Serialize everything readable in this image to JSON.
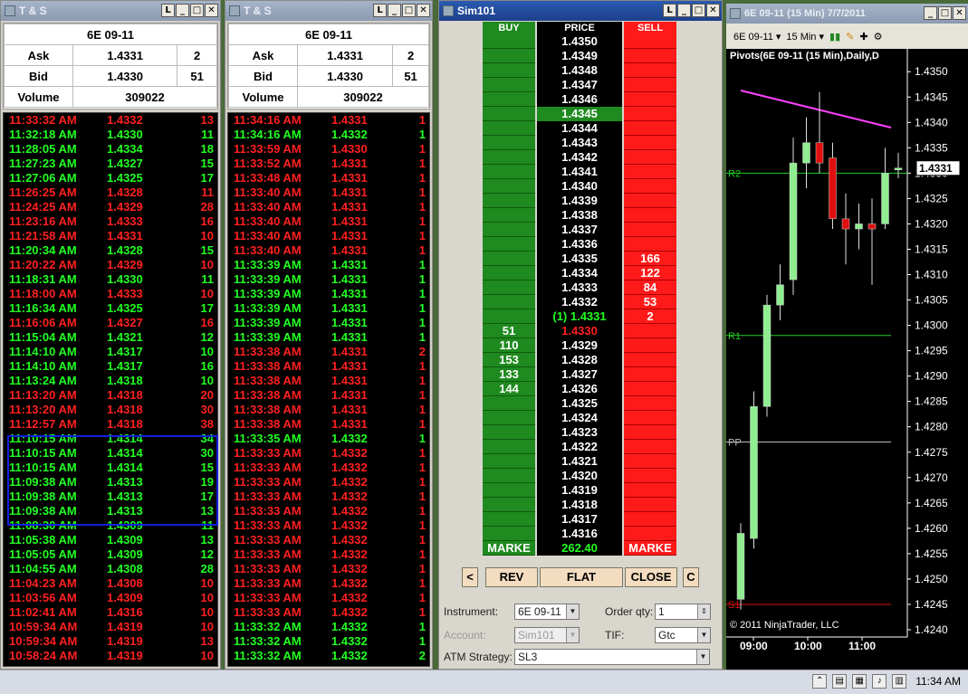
{
  "ts1": {
    "title": "T & S",
    "instrument": "6E 09-11",
    "ask_label": "Ask",
    "ask_price": "1.4331",
    "ask_size": "2",
    "bid_label": "Bid",
    "bid_price": "1.4330",
    "bid_size": "51",
    "volume_label": "Volume",
    "volume": "309022",
    "trades": [
      [
        "11:33:32 AM",
        "1.4332",
        "13",
        "r"
      ],
      [
        "11:32:18 AM",
        "1.4330",
        "11",
        "g"
      ],
      [
        "11:28:05 AM",
        "1.4334",
        "18",
        "g"
      ],
      [
        "11:27:23 AM",
        "1.4327",
        "15",
        "g"
      ],
      [
        "11:27:06 AM",
        "1.4325",
        "17",
        "g"
      ],
      [
        "11:26:25 AM",
        "1.4328",
        "11",
        "r"
      ],
      [
        "11:24:25 AM",
        "1.4329",
        "28",
        "r"
      ],
      [
        "11:23:16 AM",
        "1.4333",
        "16",
        "r"
      ],
      [
        "11:21:58 AM",
        "1.4331",
        "10",
        "r"
      ],
      [
        "11:20:34 AM",
        "1.4328",
        "15",
        "g"
      ],
      [
        "11:20:22 AM",
        "1.4329",
        "10",
        "r"
      ],
      [
        "11:18:31 AM",
        "1.4330",
        "11",
        "g"
      ],
      [
        "11:18:00 AM",
        "1.4333",
        "10",
        "r"
      ],
      [
        "11:16:34 AM",
        "1.4325",
        "17",
        "g"
      ],
      [
        "11:16:06 AM",
        "1.4327",
        "16",
        "r"
      ],
      [
        "11:15:04 AM",
        "1.4321",
        "12",
        "g"
      ],
      [
        "11:14:10 AM",
        "1.4317",
        "10",
        "g"
      ],
      [
        "11:14:10 AM",
        "1.4317",
        "16",
        "g"
      ],
      [
        "11:13:24 AM",
        "1.4318",
        "10",
        "g"
      ],
      [
        "11:13:20 AM",
        "1.4318",
        "20",
        "r"
      ],
      [
        "11:13:20 AM",
        "1.4318",
        "30",
        "r"
      ],
      [
        "11:12:57 AM",
        "1.4318",
        "38",
        "r"
      ],
      [
        "11:10:15 AM",
        "1.4314",
        "34",
        "g"
      ],
      [
        "11:10:15 AM",
        "1.4314",
        "30",
        "g"
      ],
      [
        "11:10:15 AM",
        "1.4314",
        "15",
        "g"
      ],
      [
        "11:09:38 AM",
        "1.4313",
        "19",
        "g"
      ],
      [
        "11:09:38 AM",
        "1.4313",
        "17",
        "g"
      ],
      [
        "11:09:38 AM",
        "1.4313",
        "13",
        "g"
      ],
      [
        "11:08:30 AM",
        "1.4309",
        "11",
        "g"
      ],
      [
        "11:05:38 AM",
        "1.4309",
        "13",
        "g"
      ],
      [
        "11:05:05 AM",
        "1.4309",
        "12",
        "g"
      ],
      [
        "11:04:55 AM",
        "1.4308",
        "28",
        "g"
      ],
      [
        "11:04:23 AM",
        "1.4308",
        "10",
        "r"
      ],
      [
        "11:03:56 AM",
        "1.4309",
        "10",
        "r"
      ],
      [
        "11:02:41 AM",
        "1.4316",
        "10",
        "r"
      ],
      [
        "10:59:34 AM",
        "1.4319",
        "10",
        "r"
      ],
      [
        "10:59:34 AM",
        "1.4319",
        "13",
        "r"
      ],
      [
        "10:58:24 AM",
        "1.4319",
        "10",
        "r"
      ]
    ]
  },
  "ts2": {
    "title": "T & S",
    "instrument": "6E 09-11",
    "ask_label": "Ask",
    "ask_price": "1.4331",
    "ask_size": "2",
    "bid_label": "Bid",
    "bid_price": "1.4330",
    "bid_size": "51",
    "volume_label": "Volume",
    "volume": "309022",
    "trades": [
      [
        "11:34:16 AM",
        "1.4331",
        "1",
        "r"
      ],
      [
        "11:34:16 AM",
        "1.4332",
        "1",
        "g"
      ],
      [
        "11:33:59 AM",
        "1.4330",
        "1",
        "r"
      ],
      [
        "11:33:52 AM",
        "1.4331",
        "1",
        "r"
      ],
      [
        "11:33:48 AM",
        "1.4331",
        "1",
        "r"
      ],
      [
        "11:33:40 AM",
        "1.4331",
        "1",
        "r"
      ],
      [
        "11:33:40 AM",
        "1.4331",
        "1",
        "r"
      ],
      [
        "11:33:40 AM",
        "1.4331",
        "1",
        "r"
      ],
      [
        "11:33:40 AM",
        "1.4331",
        "1",
        "r"
      ],
      [
        "11:33:40 AM",
        "1.4331",
        "1",
        "r"
      ],
      [
        "11:33:39 AM",
        "1.4331",
        "1",
        "g"
      ],
      [
        "11:33:39 AM",
        "1.4331",
        "1",
        "g"
      ],
      [
        "11:33:39 AM",
        "1.4331",
        "1",
        "g"
      ],
      [
        "11:33:39 AM",
        "1.4331",
        "1",
        "g"
      ],
      [
        "11:33:39 AM",
        "1.4331",
        "1",
        "g"
      ],
      [
        "11:33:39 AM",
        "1.4331",
        "1",
        "g"
      ],
      [
        "11:33:38 AM",
        "1.4331",
        "2",
        "r"
      ],
      [
        "11:33:38 AM",
        "1.4331",
        "1",
        "r"
      ],
      [
        "11:33:38 AM",
        "1.4331",
        "1",
        "r"
      ],
      [
        "11:33:38 AM",
        "1.4331",
        "1",
        "r"
      ],
      [
        "11:33:38 AM",
        "1.4331",
        "1",
        "r"
      ],
      [
        "11:33:38 AM",
        "1.4331",
        "1",
        "r"
      ],
      [
        "11:33:35 AM",
        "1.4332",
        "1",
        "g"
      ],
      [
        "11:33:33 AM",
        "1.4332",
        "1",
        "r"
      ],
      [
        "11:33:33 AM",
        "1.4332",
        "1",
        "r"
      ],
      [
        "11:33:33 AM",
        "1.4332",
        "1",
        "r"
      ],
      [
        "11:33:33 AM",
        "1.4332",
        "1",
        "r"
      ],
      [
        "11:33:33 AM",
        "1.4332",
        "1",
        "r"
      ],
      [
        "11:33:33 AM",
        "1.4332",
        "1",
        "r"
      ],
      [
        "11:33:33 AM",
        "1.4332",
        "1",
        "r"
      ],
      [
        "11:33:33 AM",
        "1.4332",
        "1",
        "r"
      ],
      [
        "11:33:33 AM",
        "1.4332",
        "1",
        "r"
      ],
      [
        "11:33:33 AM",
        "1.4332",
        "1",
        "r"
      ],
      [
        "11:33:33 AM",
        "1.4332",
        "1",
        "r"
      ],
      [
        "11:33:33 AM",
        "1.4332",
        "1",
        "r"
      ],
      [
        "11:33:32 AM",
        "1.4332",
        "1",
        "g"
      ],
      [
        "11:33:32 AM",
        "1.4332",
        "1",
        "g"
      ],
      [
        "11:33:32 AM",
        "1.4332",
        "2",
        "g"
      ]
    ]
  },
  "dom": {
    "title": "Sim101",
    "col_buy": "BUY",
    "col_price": "PRICE",
    "col_sell": "SELL",
    "rows": [
      [
        "",
        "1.4350",
        ""
      ],
      [
        "",
        "1.4349",
        ""
      ],
      [
        "",
        "1.4348",
        ""
      ],
      [
        "",
        "1.4347",
        ""
      ],
      [
        "",
        "1.4346",
        ""
      ],
      [
        "",
        "1.4345",
        ""
      ],
      [
        "",
        "1.4344",
        ""
      ],
      [
        "",
        "1.4343",
        ""
      ],
      [
        "",
        "1.4342",
        ""
      ],
      [
        "",
        "1.4341",
        ""
      ],
      [
        "",
        "1.4340",
        ""
      ],
      [
        "",
        "1.4339",
        ""
      ],
      [
        "",
        "1.4338",
        ""
      ],
      [
        "",
        "1.4337",
        ""
      ],
      [
        "",
        "1.4336",
        ""
      ],
      [
        "",
        "1.4335",
        "166"
      ],
      [
        "",
        "1.4334",
        "122"
      ],
      [
        "",
        "1.4333",
        "84"
      ],
      [
        "",
        "1.4332",
        "53"
      ],
      [
        "",
        "(1) 1.4331",
        "2"
      ],
      [
        "51",
        "1.4330",
        ""
      ],
      [
        "110",
        "1.4329",
        ""
      ],
      [
        "153",
        "1.4328",
        ""
      ],
      [
        "133",
        "1.4327",
        ""
      ],
      [
        "144",
        "1.4326",
        ""
      ],
      [
        "",
        "1.4325",
        ""
      ],
      [
        "",
        "1.4324",
        ""
      ],
      [
        "",
        "1.4323",
        ""
      ],
      [
        "",
        "1.4322",
        ""
      ],
      [
        "",
        "1.4321",
        ""
      ],
      [
        "",
        "1.4320",
        ""
      ],
      [
        "",
        "1.4319",
        ""
      ],
      [
        "",
        "1.4318",
        ""
      ],
      [
        "",
        "1.4317",
        ""
      ],
      [
        "",
        "1.4316",
        ""
      ]
    ],
    "market_buy": "MARKE",
    "pnl": "262.40",
    "market_sell": "MARKE",
    "btn_left": "<",
    "btn_rev": "REV",
    "btn_flat": "FLAT",
    "btn_close": "CLOSE",
    "btn_c": "C",
    "instrument_label": "Instrument:",
    "instrument_value": "6E 09-11",
    "orderqty_label": "Order qty:",
    "orderqty_value": "1",
    "account_label": "Account:",
    "account_value": "Sim101",
    "tif_label": "TIF:",
    "tif_value": "Gtc",
    "atm_label": "ATM Strategy:",
    "atm_value": "SL3",
    "colors": {
      "buy": "#1f8a1f",
      "sell": "#ff1a1a",
      "last_trade": "#1f8a1f"
    }
  },
  "chart": {
    "title": "6E 09-11 (15 Min)  7/7/2011",
    "toolbar_instrument": "6E 09-11",
    "toolbar_interval": "15 Min",
    "header_label": "Pivots(6E 09-11 (15 Min),Daily,D",
    "copyright": "© 2011 NinjaTrader, LLC",
    "r2_label": "R2",
    "r1_label": "R1",
    "pp_label": "PP",
    "s1_label": "S1",
    "current_price": "1.4331",
    "chart_data": {
      "type": "candlestick",
      "y_ticks": [
        "1.4350",
        "1.4345",
        "1.4340",
        "1.4335",
        "1.4330",
        "1.4325",
        "1.4320",
        "1.4315",
        "1.4310",
        "1.4305",
        "1.4300",
        "1.4295",
        "1.4290",
        "1.4285",
        "1.4280",
        "1.4275",
        "1.4270",
        "1.4265",
        "1.4260",
        "1.4255",
        "1.4250",
        "1.4245",
        "1.4240"
      ],
      "x_ticks": [
        "09:00",
        "10:00",
        "11:00"
      ],
      "ylim": [
        1.424,
        1.4352
      ],
      "candles": [
        {
          "o": 1.4246,
          "h": 1.4261,
          "l": 1.4244,
          "c": 1.4259
        },
        {
          "o": 1.4258,
          "h": 1.4287,
          "l": 1.4256,
          "c": 1.4284
        },
        {
          "o": 1.4284,
          "h": 1.4306,
          "l": 1.4282,
          "c": 1.4304
        },
        {
          "o": 1.4304,
          "h": 1.4312,
          "l": 1.4301,
          "c": 1.4308
        },
        {
          "o": 1.4309,
          "h": 1.4337,
          "l": 1.4306,
          "c": 1.4332
        },
        {
          "o": 1.4332,
          "h": 1.4341,
          "l": 1.4327,
          "c": 1.4336
        },
        {
          "o": 1.4336,
          "h": 1.4346,
          "l": 1.433,
          "c": 1.4332
        },
        {
          "o": 1.4333,
          "h": 1.4336,
          "l": 1.4319,
          "c": 1.4321
        },
        {
          "o": 1.4321,
          "h": 1.4326,
          "l": 1.4312,
          "c": 1.4319
        },
        {
          "o": 1.4319,
          "h": 1.4324,
          "l": 1.4315,
          "c": 1.432
        },
        {
          "o": 1.432,
          "h": 1.4325,
          "l": 1.4308,
          "c": 1.4319
        },
        {
          "o": 1.432,
          "h": 1.4335,
          "l": 1.4319,
          "c": 1.433
        },
        {
          "o": 1.4331,
          "h": 1.4334,
          "l": 1.4329,
          "c": 1.4331
        }
      ],
      "pivots": {
        "R2": 1.433,
        "R1": 1.4298,
        "PP": 1.4277,
        "S1": 1.4245
      },
      "grid": false
    },
    "colors": {
      "up": "#90ee90",
      "down": "#e01010",
      "pivot_line": "#ff40ff",
      "r_line": "#22cc22",
      "pp_line": "#bbbbbb",
      "s_line": "#e01010"
    }
  },
  "taskbar": {
    "clock": "11:34 AM"
  }
}
